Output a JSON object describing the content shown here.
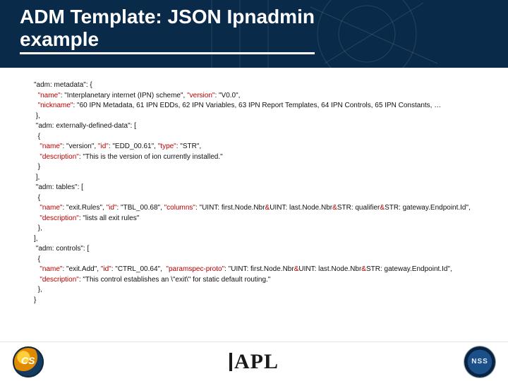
{
  "title_line1": "ADM Template: JSON Ipnadmin",
  "title_line2": "example",
  "code": {
    "l01a": "\"adm: metadata\"",
    "l01b": ": {",
    "l02a": "  \"name\"",
    "l02b": ": \"Interplanetary internet (IPN) scheme\", ",
    "l02c": "\"version\"",
    "l02d": ": \"V0.0\",",
    "l03a": "  \"nickname\"",
    "l03b": ": \"60 IPN Metadata, 61 IPN EDDs, 62 IPN Variables, 63 IPN Report Templates, 64 IPN Controls, 65 IPN Constants, …",
    "l04": " },",
    "l05": " \"adm: externally-defined-data\": [",
    "l06": "  {",
    "l07a": "   \"name\"",
    "l07b": ": \"version\", ",
    "l07c": "\"id\"",
    "l07d": ": \"EDD_00.61\", ",
    "l07e": "\"type\"",
    "l07f": ": \"STR\",",
    "l08a": "   \"description\"",
    "l08b": ": \"This is the version of ion currently installed.\"",
    "l09": "  }",
    "l10": " ],",
    "l11": " \"adm: tables\": [",
    "l12": "  {",
    "l13a": "   \"name\"",
    "l13b": ": \"exit.Rules\", ",
    "l13c": "\"id\"",
    "l13d": ": \"TBL_00.68\", ",
    "l13e": "\"columns\"",
    "l13f": ": \"UINT: first.Node.Nbr",
    "l13g": "&",
    "l13h": "UINT: last.Node.Nbr",
    "l13i": "&",
    "l13j": "STR: qualifier",
    "l13k": "&",
    "l13l": "STR: gateway.Endpoint.Id\",",
    "l14a": "   \"description\"",
    "l14b": ": \"lists all exit rules\"",
    "l15": "  },",
    "l16": "],",
    "l17": " \"adm: controls\": [",
    "l18": "  {",
    "l19a": "   \"name\"",
    "l19b": ": \"exit.Add\", ",
    "l19c": "\"id\"",
    "l19d": ": \"CTRL_00.64\",  ",
    "l19e": "\"paramspec-proto\"",
    "l19f": ": \"UINT: first.Node.Nbr",
    "l19g": "&",
    "l19h": "UINT: last.Node.Nbr",
    "l19i": "&",
    "l19j": "STR: gateway.Endpoint.Id\",",
    "l20a": "   \"description\"",
    "l20b": ": \"This control establishes an \\\"exit\\\" for static default routing.\"",
    "l21": "  },",
    "l22": "}"
  },
  "logos": {
    "cs": "CS",
    "apl": "APL",
    "nss": "NSS"
  }
}
